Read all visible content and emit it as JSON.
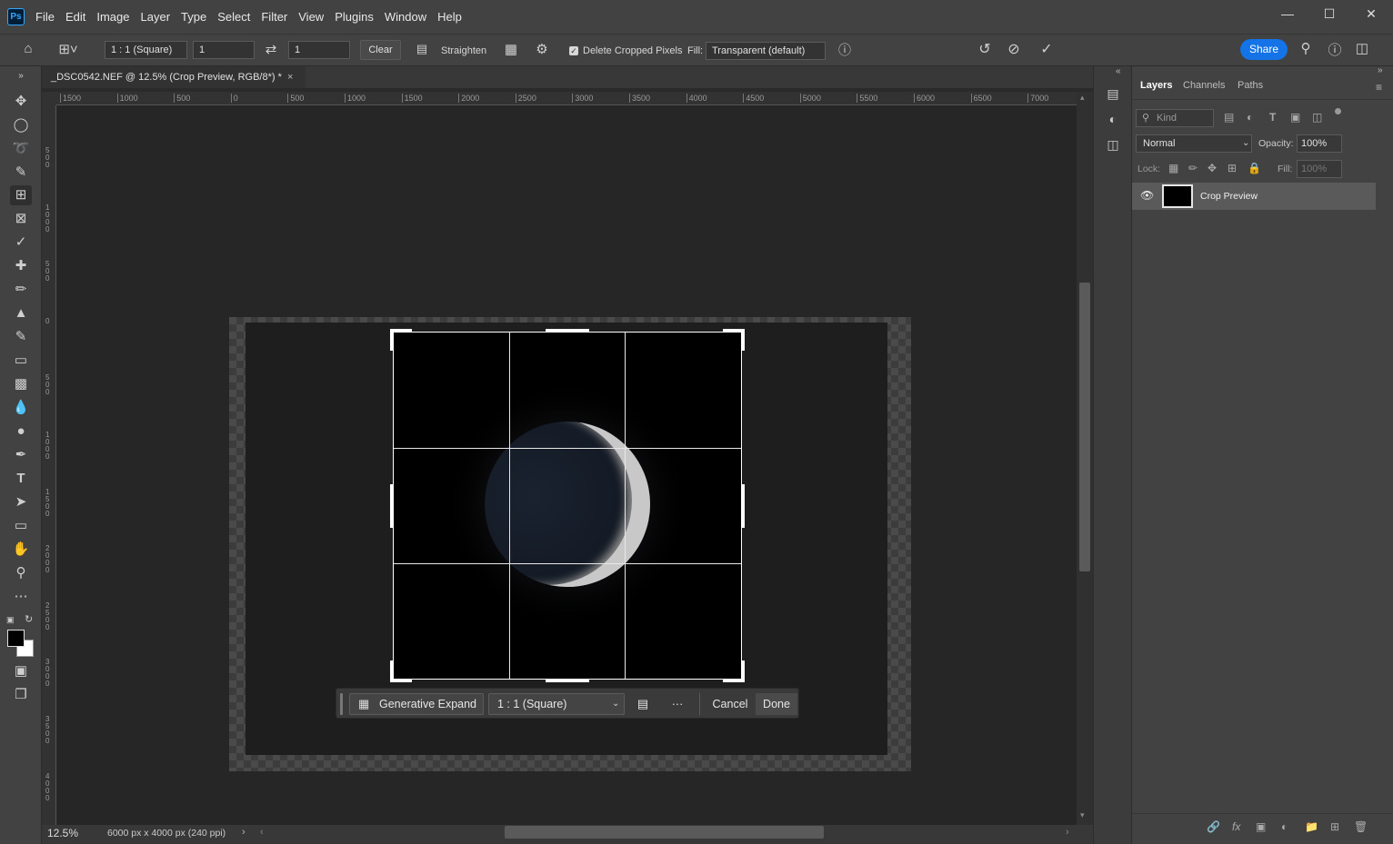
{
  "app": {
    "logo": "Ps",
    "menus": [
      "File",
      "Edit",
      "Image",
      "Layer",
      "Type",
      "Select",
      "Filter",
      "View",
      "Plugins",
      "Window",
      "Help"
    ],
    "window_controls": [
      "minimize-icon",
      "maximize-icon",
      "close-icon"
    ]
  },
  "options_bar": {
    "ratio": "1 : 1 (Square)",
    "width_value": "1",
    "height_value": "1",
    "clear_label": "Clear",
    "straighten_label": "Straighten",
    "delete_cropped_label": "Delete Cropped Pixels",
    "delete_cropped_checked": true,
    "fill_label": "Fill:",
    "fill_value": "Transparent (default)",
    "share_label": "Share"
  },
  "document": {
    "tab_title": "_DSC0542.NEF @ 12.5% (Crop Preview, RGB/8*) *",
    "zoom": "12.5%",
    "info": "6000 px x 4000 px (240 ppi)"
  },
  "ruler": {
    "h_labels": [
      "1500",
      "1000",
      "500",
      "0",
      "500",
      "1000",
      "1500",
      "2000",
      "2500",
      "3000",
      "3500",
      "4000",
      "4500",
      "5000",
      "5500",
      "6000",
      "6500",
      "7000"
    ],
    "v_labels": [
      "5 0 0",
      "1 0 0 0",
      "5 0 0",
      "0",
      "5 0 0",
      "1 0 0 0",
      "1 5 0 0",
      "2 0 0 0",
      "2 5 0 0",
      "3 0 0 0",
      "3 5 0 0",
      "4 0 0 0",
      "4 5 0 0"
    ]
  },
  "crop_toolbar": {
    "generative_expand_label": "Generative Expand",
    "ratio": "1 : 1 (Square)",
    "more_label": "···",
    "cancel_label": "Cancel",
    "done_label": "Done"
  },
  "layers_panel": {
    "tabs": [
      "Layers",
      "Channels",
      "Paths"
    ],
    "active_tab": "Layers",
    "filter_kind": "Kind",
    "blend_mode": "Normal",
    "opacity_label": "Opacity:",
    "opacity_value": "100%",
    "lock_label": "Lock:",
    "fill_label": "Fill:",
    "fill_value": "100%",
    "layers": [
      {
        "name": "Crop Preview",
        "visible": true
      }
    ]
  },
  "colors": {
    "accent": "#1473e6",
    "panel_bg": "#424242",
    "canvas_bg": "#262626"
  }
}
